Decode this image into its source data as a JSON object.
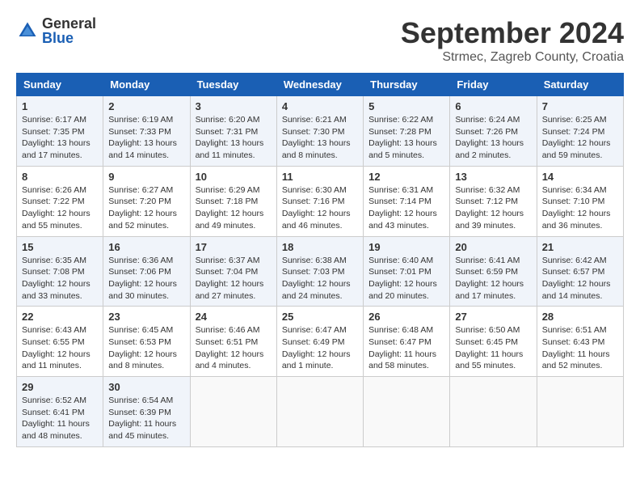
{
  "logo": {
    "general": "General",
    "blue": "Blue"
  },
  "header": {
    "month": "September 2024",
    "location": "Strmec, Zagreb County, Croatia"
  },
  "weekdays": [
    "Sunday",
    "Monday",
    "Tuesday",
    "Wednesday",
    "Thursday",
    "Friday",
    "Saturday"
  ],
  "weeks": [
    [
      {
        "day": "1",
        "info": "Sunrise: 6:17 AM\nSunset: 7:35 PM\nDaylight: 13 hours\nand 17 minutes."
      },
      {
        "day": "2",
        "info": "Sunrise: 6:19 AM\nSunset: 7:33 PM\nDaylight: 13 hours\nand 14 minutes."
      },
      {
        "day": "3",
        "info": "Sunrise: 6:20 AM\nSunset: 7:31 PM\nDaylight: 13 hours\nand 11 minutes."
      },
      {
        "day": "4",
        "info": "Sunrise: 6:21 AM\nSunset: 7:30 PM\nDaylight: 13 hours\nand 8 minutes."
      },
      {
        "day": "5",
        "info": "Sunrise: 6:22 AM\nSunset: 7:28 PM\nDaylight: 13 hours\nand 5 minutes."
      },
      {
        "day": "6",
        "info": "Sunrise: 6:24 AM\nSunset: 7:26 PM\nDaylight: 13 hours\nand 2 minutes."
      },
      {
        "day": "7",
        "info": "Sunrise: 6:25 AM\nSunset: 7:24 PM\nDaylight: 12 hours\nand 59 minutes."
      }
    ],
    [
      {
        "day": "8",
        "info": "Sunrise: 6:26 AM\nSunset: 7:22 PM\nDaylight: 12 hours\nand 55 minutes."
      },
      {
        "day": "9",
        "info": "Sunrise: 6:27 AM\nSunset: 7:20 PM\nDaylight: 12 hours\nand 52 minutes."
      },
      {
        "day": "10",
        "info": "Sunrise: 6:29 AM\nSunset: 7:18 PM\nDaylight: 12 hours\nand 49 minutes."
      },
      {
        "day": "11",
        "info": "Sunrise: 6:30 AM\nSunset: 7:16 PM\nDaylight: 12 hours\nand 46 minutes."
      },
      {
        "day": "12",
        "info": "Sunrise: 6:31 AM\nSunset: 7:14 PM\nDaylight: 12 hours\nand 43 minutes."
      },
      {
        "day": "13",
        "info": "Sunrise: 6:32 AM\nSunset: 7:12 PM\nDaylight: 12 hours\nand 39 minutes."
      },
      {
        "day": "14",
        "info": "Sunrise: 6:34 AM\nSunset: 7:10 PM\nDaylight: 12 hours\nand 36 minutes."
      }
    ],
    [
      {
        "day": "15",
        "info": "Sunrise: 6:35 AM\nSunset: 7:08 PM\nDaylight: 12 hours\nand 33 minutes."
      },
      {
        "day": "16",
        "info": "Sunrise: 6:36 AM\nSunset: 7:06 PM\nDaylight: 12 hours\nand 30 minutes."
      },
      {
        "day": "17",
        "info": "Sunrise: 6:37 AM\nSunset: 7:04 PM\nDaylight: 12 hours\nand 27 minutes."
      },
      {
        "day": "18",
        "info": "Sunrise: 6:38 AM\nSunset: 7:03 PM\nDaylight: 12 hours\nand 24 minutes."
      },
      {
        "day": "19",
        "info": "Sunrise: 6:40 AM\nSunset: 7:01 PM\nDaylight: 12 hours\nand 20 minutes."
      },
      {
        "day": "20",
        "info": "Sunrise: 6:41 AM\nSunset: 6:59 PM\nDaylight: 12 hours\nand 17 minutes."
      },
      {
        "day": "21",
        "info": "Sunrise: 6:42 AM\nSunset: 6:57 PM\nDaylight: 12 hours\nand 14 minutes."
      }
    ],
    [
      {
        "day": "22",
        "info": "Sunrise: 6:43 AM\nSunset: 6:55 PM\nDaylight: 12 hours\nand 11 minutes."
      },
      {
        "day": "23",
        "info": "Sunrise: 6:45 AM\nSunset: 6:53 PM\nDaylight: 12 hours\nand 8 minutes."
      },
      {
        "day": "24",
        "info": "Sunrise: 6:46 AM\nSunset: 6:51 PM\nDaylight: 12 hours\nand 4 minutes."
      },
      {
        "day": "25",
        "info": "Sunrise: 6:47 AM\nSunset: 6:49 PM\nDaylight: 12 hours\nand 1 minute."
      },
      {
        "day": "26",
        "info": "Sunrise: 6:48 AM\nSunset: 6:47 PM\nDaylight: 11 hours\nand 58 minutes."
      },
      {
        "day": "27",
        "info": "Sunrise: 6:50 AM\nSunset: 6:45 PM\nDaylight: 11 hours\nand 55 minutes."
      },
      {
        "day": "28",
        "info": "Sunrise: 6:51 AM\nSunset: 6:43 PM\nDaylight: 11 hours\nand 52 minutes."
      }
    ],
    [
      {
        "day": "29",
        "info": "Sunrise: 6:52 AM\nSunset: 6:41 PM\nDaylight: 11 hours\nand 48 minutes."
      },
      {
        "day": "30",
        "info": "Sunrise: 6:54 AM\nSunset: 6:39 PM\nDaylight: 11 hours\nand 45 minutes."
      },
      {
        "day": "",
        "info": ""
      },
      {
        "day": "",
        "info": ""
      },
      {
        "day": "",
        "info": ""
      },
      {
        "day": "",
        "info": ""
      },
      {
        "day": "",
        "info": ""
      }
    ]
  ]
}
